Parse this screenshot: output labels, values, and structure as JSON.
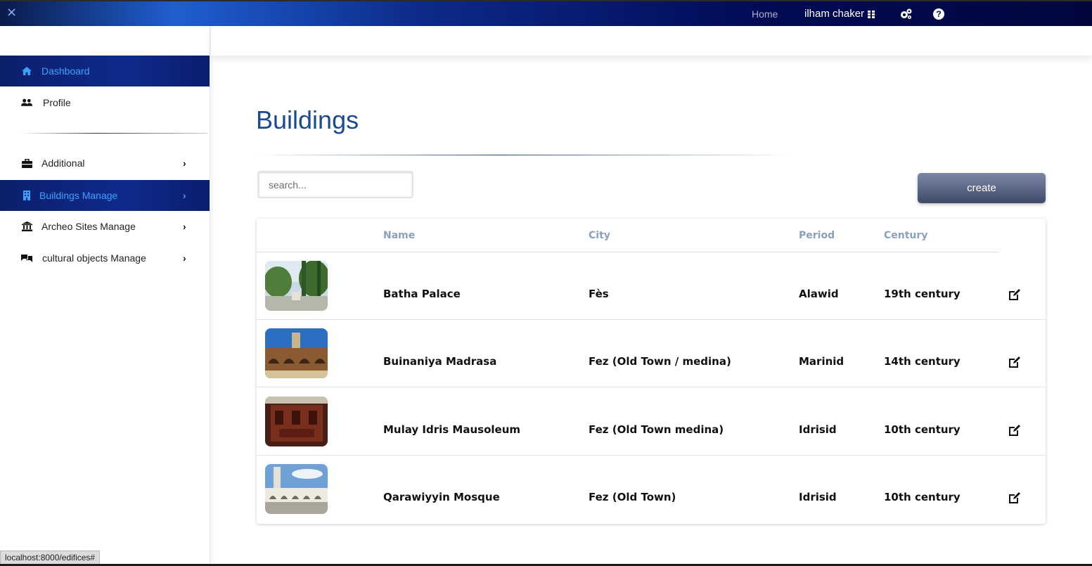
{
  "topbar": {
    "close_icon": "×",
    "home_label": "Home",
    "user_name": "ilham chaker",
    "grid_icon": "grid-icon",
    "gear_icon": "gears-icon",
    "help_icon": "?"
  },
  "sidebar": {
    "items": [
      {
        "label": "Dashboard",
        "icon": "home-icon",
        "active": true
      },
      {
        "label": "Profile",
        "icon": "users-icon",
        "active": false
      },
      {
        "label": "Additional",
        "icon": "toolbox-icon",
        "active": false,
        "chevron": "›"
      },
      {
        "label": "Buildings Manage",
        "icon": "building-icon",
        "active": true,
        "chevron": "›"
      },
      {
        "label": "Archeo Sites Manage",
        "icon": "landmark-icon",
        "active": false,
        "chevron": "›"
      },
      {
        "label": "cultural objects Manage",
        "icon": "objects-icon",
        "active": false,
        "chevron": "›"
      }
    ]
  },
  "main": {
    "title": "Buildings",
    "search_placeholder": "search...",
    "create_label": "create",
    "table": {
      "columns": [
        "Name",
        "City",
        "Period",
        "Century"
      ],
      "rows": [
        {
          "name": "Batha Palace",
          "city": "Fès",
          "period": "Alawid",
          "century": "19th century"
        },
        {
          "name": "Buinaniya Madrasa",
          "city": "Fez (Old Town / medina)",
          "period": "Marinid",
          "century": "14th century"
        },
        {
          "name": "Mulay Idris Mausoleum",
          "city": "Fez (Old Town medina)",
          "period": "Idrisid",
          "century": "10th century"
        },
        {
          "name": "Qarawiyyin Mosque",
          "city": "Fez (Old Town)",
          "period": "Idrisid",
          "century": "10th century"
        }
      ]
    }
  },
  "status_url": "localhost:8000/edifices#",
  "colors": {
    "accent_blue": "#1c4a8e",
    "active_text": "#3aa3ff",
    "header_text": "#8aa0bc"
  }
}
